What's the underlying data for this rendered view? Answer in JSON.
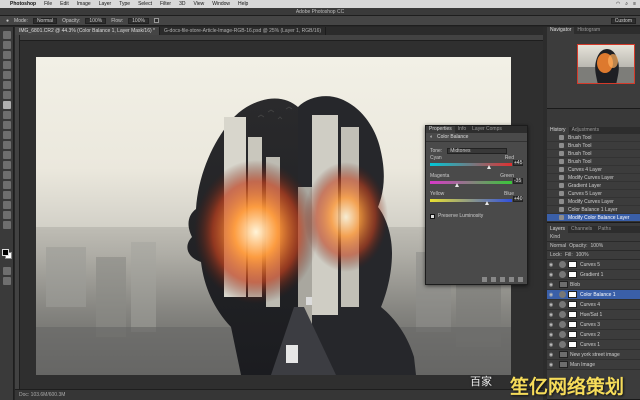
{
  "menubar": {
    "app": "Photoshop",
    "items": [
      "File",
      "Edit",
      "Image",
      "Layer",
      "Type",
      "Select",
      "Filter",
      "3D",
      "View",
      "Window",
      "Help"
    ]
  },
  "window": {
    "title": "Adobe Photoshop CC"
  },
  "options": {
    "mode_label": "Mode:",
    "mode_value": "Normal",
    "opacity_label": "Opacity:",
    "opacity_value": "100%",
    "flow_label": "Flow:",
    "flow_value": "100%",
    "workspace_value": "Custom"
  },
  "doc_tabs": [
    {
      "label": "IMG_6801.CR2 @ 44.3% (Color Balance 1, Layer Mask/16) *",
      "active": true
    },
    {
      "label": "G-docs-file-store-Article-Image-RGB-16.psd @ 25% (Layer 1, RGB/16)",
      "active": false
    }
  ],
  "status": {
    "text": "Doc: 103.6M/600.3M"
  },
  "panels": {
    "navigator_tabs": [
      "Navigator",
      "Histogram"
    ],
    "history_tabs": [
      "History",
      "Adjustments"
    ],
    "history_items": [
      {
        "label": "Brush Tool",
        "active": false
      },
      {
        "label": "Brush Tool",
        "active": false
      },
      {
        "label": "Brush Tool",
        "active": false
      },
      {
        "label": "Brush Tool",
        "active": false
      },
      {
        "label": "Curves 4 Layer",
        "active": false
      },
      {
        "label": "Modify Curves Layer",
        "active": false
      },
      {
        "label": "Gradient Layer",
        "active": false
      },
      {
        "label": "Curves 5 Layer",
        "active": false
      },
      {
        "label": "Modify Curves Layer",
        "active": false
      },
      {
        "label": "Color Balance 1 Layer",
        "active": false
      },
      {
        "label": "Modify Color Balance Layer",
        "active": true
      }
    ],
    "layers_tabs": [
      "Layers",
      "Channels",
      "Paths"
    ],
    "layers_kind": "Kind",
    "blend_mode": "Normal",
    "opacity_label": "Opacity:",
    "opacity_value": "100%",
    "lock_label": "Lock:",
    "fill_label": "Fill:",
    "fill_value": "100%",
    "layers": [
      {
        "name": "Curves 5",
        "type": "adjustment",
        "active": false
      },
      {
        "name": "Gradient 1",
        "type": "fill",
        "active": false
      },
      {
        "name": "Blob",
        "type": "pixel",
        "active": false
      },
      {
        "name": "Color Balance 1",
        "type": "adjustment",
        "active": true
      },
      {
        "name": "Curves 4",
        "type": "adjustment",
        "active": false
      },
      {
        "name": "Hue/Sat 1",
        "type": "adjustment",
        "active": false
      },
      {
        "name": "Curves 3",
        "type": "adjustment",
        "active": false
      },
      {
        "name": "Curves 2",
        "type": "adjustment",
        "active": false
      },
      {
        "name": "Curves 1",
        "type": "adjustment",
        "active": false
      },
      {
        "name": "New york street image",
        "type": "pixel",
        "active": false
      },
      {
        "name": "Man Image",
        "type": "pixel",
        "active": false
      }
    ]
  },
  "properties": {
    "tabs": [
      "Properties",
      "Info",
      "Layer Comps"
    ],
    "header": "Color Balance",
    "tone_label": "Tone:",
    "tone_value": "Midtones",
    "sliders": [
      {
        "left": "Cyan",
        "right": "Red",
        "value": "+45",
        "level": 0.72,
        "from": "#00c8d8",
        "to": "#e03030"
      },
      {
        "left": "Magenta",
        "right": "Green",
        "value": "-35",
        "level": 0.33,
        "from": "#d838c8",
        "to": "#38c838"
      },
      {
        "left": "Yellow",
        "right": "Blue",
        "value": "+40",
        "level": 0.7,
        "from": "#e8e030",
        "to": "#3050e0"
      }
    ],
    "preserve_label": "Preserve Luminosity"
  },
  "watermark": {
    "cn": "百家",
    "brand": "笙亿网络策划"
  },
  "colors": {
    "selection": "#3a5fa8",
    "brand_watermark": "#f6dc5a",
    "panel": "#3c3c3c"
  }
}
